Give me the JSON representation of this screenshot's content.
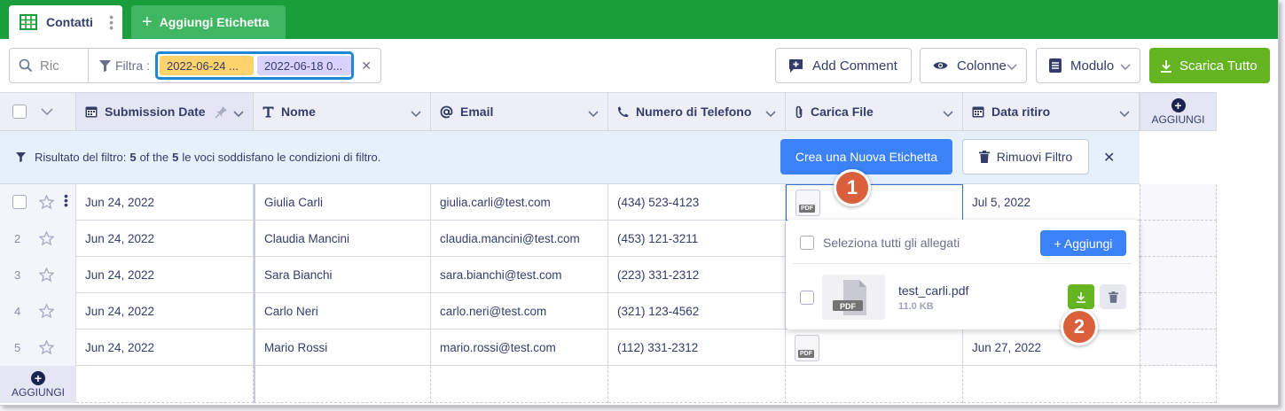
{
  "tabs": {
    "active_label": "Contatti",
    "add_label": "Aggiungi Etichetta"
  },
  "toolbar": {
    "search_placeholder": "Ric",
    "filter_label": "Filtra :",
    "filter_chip_1": "2022-06-24 ...",
    "filter_chip_2": "2022-06-18 0...",
    "add_comment": "Add Comment",
    "colonne": "Colonne",
    "modulo": "Modulo",
    "scarica": "Scarica Tutto"
  },
  "columns": [
    {
      "label": "Submission Date",
      "icon": "calendar-icon"
    },
    {
      "label": "Nome",
      "icon": "text-icon"
    },
    {
      "label": "Email",
      "icon": "at-icon"
    },
    {
      "label": "Numero di Telefono",
      "icon": "phone-icon"
    },
    {
      "label": "Carica File",
      "icon": "paperclip-icon"
    },
    {
      "label": "Data ritiro",
      "icon": "calendar-icon"
    }
  ],
  "add_column_label": "AGGIUNGI",
  "add_row_label": "AGGIUNGI",
  "filter_result": {
    "prefix": "Risultato del filtro:",
    "count": "5",
    "mid": "of the",
    "total": "5",
    "suffix": "le voci soddisfano le condizioni di filtro.",
    "create_label": "Crea una Nuova Etichetta",
    "remove_label": "Rimuovi Filtro"
  },
  "rows": [
    {
      "num": "",
      "date": "Jun 24, 2022",
      "nome": "Giulia Carli",
      "email": "giulia.carli@test.com",
      "phone": "(434) 523-4123",
      "ritiro": "Jul 5, 2022"
    },
    {
      "num": "2",
      "date": "Jun 24, 2022",
      "nome": "Claudia Mancini",
      "email": "claudia.mancini@test.com",
      "phone": "(453) 121-3211",
      "ritiro": ""
    },
    {
      "num": "3",
      "date": "Jun 24, 2022",
      "nome": "Sara Bianchi",
      "email": "sara.bianchi@test.com",
      "phone": "(223) 331-2312",
      "ritiro": ""
    },
    {
      "num": "4",
      "date": "Jun 24, 2022",
      "nome": "Carlo Neri",
      "email": "carlo.neri@test.com",
      "phone": "(321) 123-4562",
      "ritiro": ""
    },
    {
      "num": "5",
      "date": "Jun 24, 2022",
      "nome": "Mario Rossi",
      "email": "mario.rossi@test.com",
      "phone": "(112) 331-2312",
      "ritiro": "Jun 27, 2022"
    }
  ],
  "pdf_label": "PDF",
  "popup": {
    "select_all": "Seleziona tutti gli allegati",
    "add_label": "+ Aggiungi",
    "file_name": "test_carli.pdf",
    "file_size": "11.0 KB",
    "thumb_label": "PDF"
  },
  "badges": [
    "1",
    "2"
  ],
  "colors": {
    "brand_green": "#1a9e3c",
    "accent_blue": "#3b82f6",
    "download_green": "#64b521",
    "badge": "#d9603b"
  }
}
